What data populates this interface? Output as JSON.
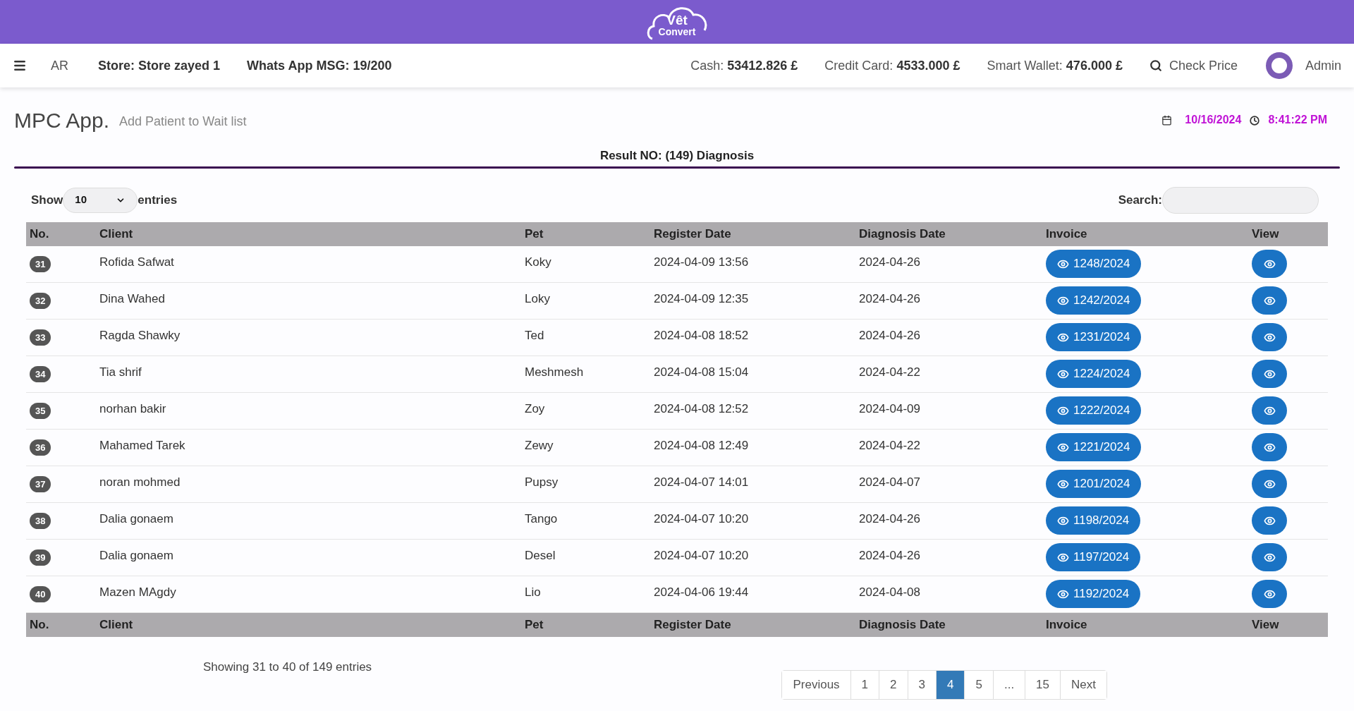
{
  "logo": {
    "line_1": "Vêt",
    "line_2": "Convert"
  },
  "navbar": {
    "language": "AR",
    "store_label": "Store:",
    "store": "Store zayed 1",
    "whatsapp_label": "Whats App MSG:",
    "whatsapp": "19/200",
    "cash_label": "Cash:",
    "cash": "53412.826 £",
    "credit_label": "Credit Card:",
    "credit": "4533.000 £",
    "wallet_label": "Smart Wallet:",
    "wallet": "476.000 £",
    "check_price": "Check Price",
    "user": "Admin"
  },
  "page": {
    "title": "MPC App.",
    "subtitle": "Add Patient to Wait list",
    "date": "10/16/2024",
    "time": "8:41:22 PM",
    "result_heading": "Result NO: (149) Diagnosis"
  },
  "controls": {
    "show_label": "Show",
    "page_size": "10",
    "entries_label": "entries",
    "search_label": "Search:"
  },
  "table": {
    "columns": [
      "No.",
      "Client",
      "Pet",
      "Register Date",
      "Diagnosis Date",
      "Invoice",
      "View"
    ],
    "rows": [
      {
        "no": "31",
        "client": "Rofida Safwat",
        "pet": "Koky",
        "register": "2024-04-09 13:56",
        "diagnosis": "2024-04-26",
        "invoice": "1248/2024"
      },
      {
        "no": "32",
        "client": "Dina Wahed",
        "pet": "Loky",
        "register": "2024-04-09 12:35",
        "diagnosis": "2024-04-26",
        "invoice": "1242/2024"
      },
      {
        "no": "33",
        "client": "Ragda Shawky",
        "pet": "Ted",
        "register": "2024-04-08 18:52",
        "diagnosis": "2024-04-26",
        "invoice": "1231/2024"
      },
      {
        "no": "34",
        "client": "Tia shrif",
        "pet": "Meshmesh",
        "register": "2024-04-08 15:04",
        "diagnosis": "2024-04-22",
        "invoice": "1224/2024"
      },
      {
        "no": "35",
        "client": "norhan bakir",
        "pet": "Zoy",
        "register": "2024-04-08 12:52",
        "diagnosis": "2024-04-09",
        "invoice": "1222/2024"
      },
      {
        "no": "36",
        "client": "Mahamed Tarek",
        "pet": "Zewy",
        "register": "2024-04-08 12:49",
        "diagnosis": "2024-04-22",
        "invoice": "1221/2024"
      },
      {
        "no": "37",
        "client": "noran mohmed",
        "pet": "Pupsy",
        "register": "2024-04-07 14:01",
        "diagnosis": "2024-04-07",
        "invoice": "1201/2024"
      },
      {
        "no": "38",
        "client": "Dalia gonaem",
        "pet": "Tango",
        "register": "2024-04-07 10:20",
        "diagnosis": "2024-04-26",
        "invoice": "1198/2024"
      },
      {
        "no": "39",
        "client": "Dalia gonaem",
        "pet": "Desel",
        "register": "2024-04-07 10:20",
        "diagnosis": "2024-04-26",
        "invoice": "1197/2024"
      },
      {
        "no": "40",
        "client": "Mazen MAgdy",
        "pet": "Lio",
        "register": "2024-04-06 19:44",
        "diagnosis": "2024-04-08",
        "invoice": "1192/2024"
      }
    ],
    "footer_columns": [
      "No.",
      "Client",
      "Pet",
      "Register Date",
      "Diagnosis Date",
      "Invoice",
      "View"
    ]
  },
  "info": "Showing 31 to 40 of 149 entries",
  "pagination": [
    {
      "label": "Previous",
      "selected": false
    },
    {
      "label": "1",
      "selected": false
    },
    {
      "label": "2",
      "selected": false
    },
    {
      "label": "3",
      "selected": false
    },
    {
      "label": "4",
      "selected": true
    },
    {
      "label": "5",
      "selected": false
    },
    {
      "label": "...",
      "selected": false
    },
    {
      "label": "15",
      "selected": false
    },
    {
      "label": "Next",
      "selected": false
    }
  ]
}
